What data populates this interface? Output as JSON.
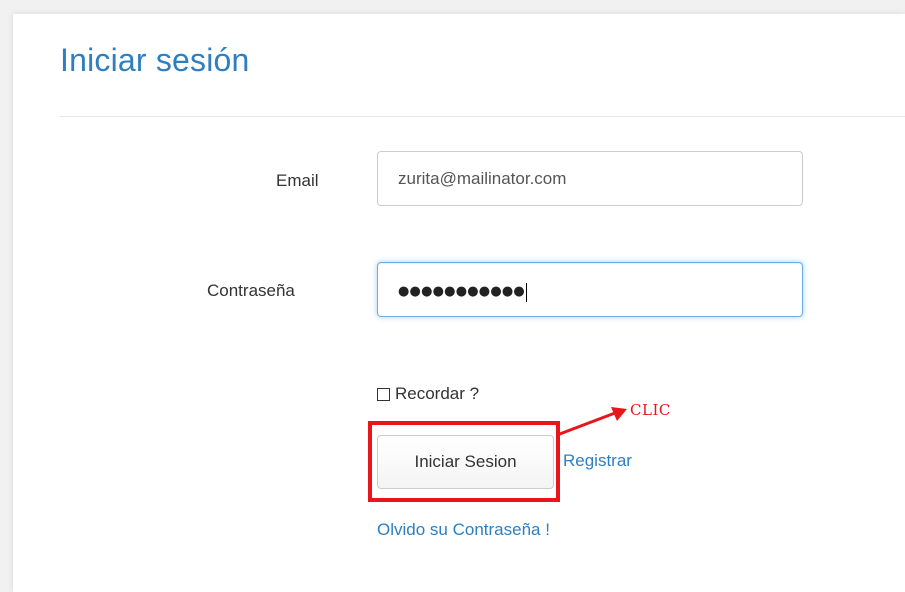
{
  "form": {
    "title": "Iniciar sesión",
    "email_label": "Email",
    "email_value": "zurita@mailinator.com",
    "password_label": "Contraseña",
    "password_masked": "●●●●●●●●●●●",
    "remember_label": "Recordar ?",
    "remember_checked": false,
    "login_button_label": "Iniciar Sesion",
    "register_link": "Registrar",
    "forgot_link": "Olvido su Contraseña !"
  },
  "annotation": {
    "text": "CLIC",
    "color": "#e8151b"
  },
  "colors": {
    "title": "#2d7fc1",
    "link": "#2d7fc1",
    "focus_border": "#66afe9"
  }
}
